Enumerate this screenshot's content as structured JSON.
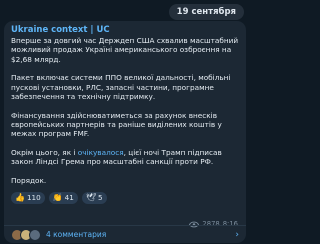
{
  "date_label": "19 сентября",
  "post": {
    "channel": "Ukraine context | UC",
    "paragraphs": [
      "Вперше за довгий час Держдеп США схвалив масштабний можливий продаж Україні американського озброєння на $2,68 млярд.",
      "Пакет включає системи ППО великої дальності, мобільні пускові установки, РЛС, запасні частини, програмне забезпечення та технічну підтримку.",
      "Фінансування здійснюватиметься за рахунок внесків європейських партнерів та раніше виділених коштів у межах програм FMF."
    ],
    "last_before": "Окрім цього, як і ",
    "last_link": "очікувалося",
    "last_after": ", цієї ночі Трамп підписав закон Ліндсі Грема про масштабні санкції проти РФ.",
    "closing": "Порядок."
  },
  "reactions": [
    {
      "emoji": "👍",
      "count": "110",
      "icon": "thumbs-up"
    },
    {
      "emoji": "👏",
      "count": "41",
      "icon": "clap"
    },
    {
      "emoji": "🕊",
      "count": "5",
      "icon": "dove"
    }
  ],
  "meta": {
    "views": "2878",
    "time": "8:16"
  },
  "comments": {
    "label": "4 комментария"
  },
  "colors": {
    "accent": "#5eb5f7",
    "bubble": "#1c2834",
    "background": "#0f1a24"
  }
}
